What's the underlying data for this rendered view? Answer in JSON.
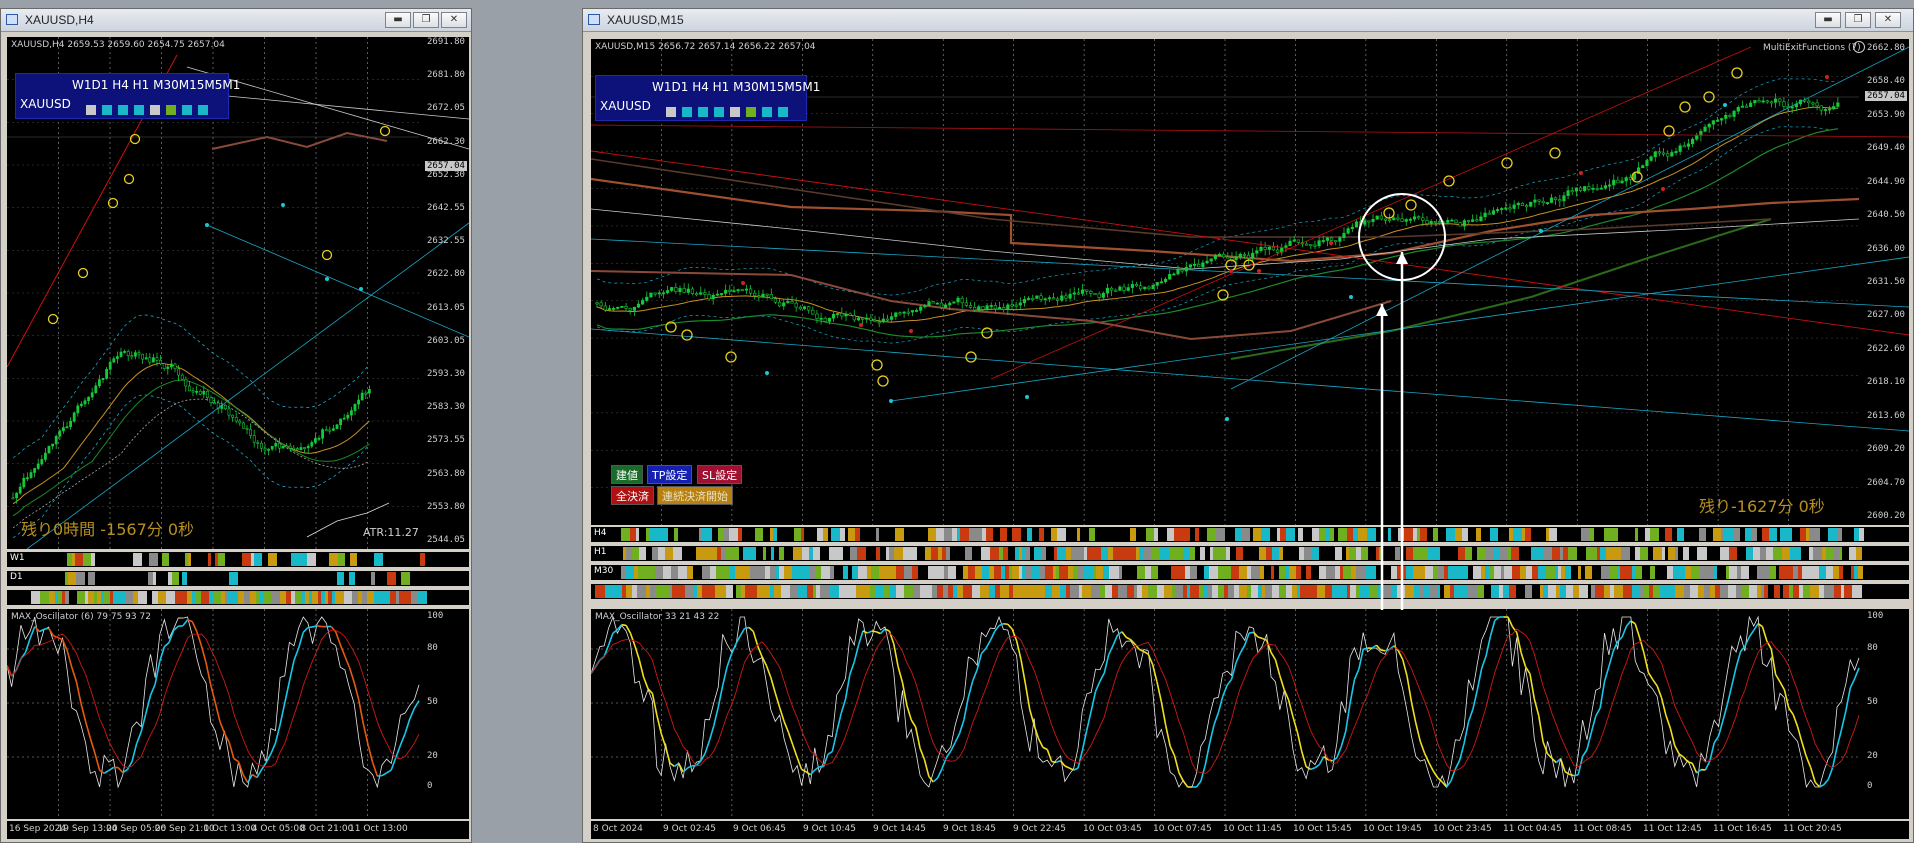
{
  "left": {
    "window_title": "XAUUSD,H4",
    "chart_header": "XAUUSD,H4  2659.53 2659.60 2654.75 2657.04",
    "tf_labels": "W1D1 H4 H1 M30M15M5M1",
    "symbol": "XAUUSD",
    "tf_squares": [
      "#c8c8c8",
      "#18b8c8",
      "#18b8c8",
      "#18b8c8",
      "#c8c8c8",
      "#70b020",
      "#18b8c8",
      "#18b8c8"
    ],
    "price_labels": [
      "2691.80",
      "2681.80",
      "2672.05",
      "2662.30",
      "2652.30",
      "2642.55",
      "2632.55",
      "2622.80",
      "2613.05",
      "2603.05",
      "2593.30",
      "2583.30",
      "2573.55",
      "2563.80",
      "2553.80",
      "2544.05"
    ],
    "current_price": "2657.04",
    "remaining": "残り0時間 -1567分 0秒",
    "atr": "ATR:11.27",
    "strip_labels": [
      "W1",
      "D1",
      ""
    ],
    "osc_title": "MAX_Oscillator (6) 79 75 93 72",
    "osc_levels": [
      "100",
      "80",
      "50",
      "20",
      "0"
    ],
    "time_labels": [
      "16 Sep 2024",
      "19 Sep 13:00",
      "24 Sep 05:00",
      "26 Sep 21:00",
      "1 Oct 13:00",
      "4 Oct 05:00",
      "8 Oct 21:00",
      "11 Oct 13:00"
    ]
  },
  "right": {
    "window_title": "XAUUSD,M15",
    "chart_header": "XAUUSD,M15  2656.72 2657.14 2656.22 2657.04",
    "indicator_name": "MultiExitFunctions (7)",
    "tf_labels": "W1D1 H4 H1 M30M15M5M1",
    "symbol": "XAUUSD",
    "tf_squares": [
      "#c8c8c8",
      "#18b8c8",
      "#18b8c8",
      "#18b8c8",
      "#c8c8c8",
      "#70b020",
      "#18b8c8",
      "#18b8c8"
    ],
    "price_labels": [
      "2662.80",
      "2658.40",
      "2653.90",
      "2649.40",
      "2644.90",
      "2640.50",
      "2636.00",
      "2631.50",
      "2627.00",
      "2622.60",
      "2618.10",
      "2613.60",
      "2609.20",
      "2604.70",
      "2600.20"
    ],
    "current_price": "2657.04",
    "buttons": {
      "entry": "建値",
      "tp": "TP設定",
      "sl": "SL設定",
      "close_all": "全決済",
      "continuous": "連続決済開始"
    },
    "remaining": "残り-1627分 0秒",
    "strip_labels": [
      "H4",
      "H1",
      "M30",
      ""
    ],
    "osc_title": "MAX_Oscillator 33 21 43 22",
    "osc_levels": [
      "100",
      "80",
      "50",
      "20",
      "0"
    ],
    "time_labels": [
      "8 Oct 2024",
      "9 Oct 02:45",
      "9 Oct 06:45",
      "9 Oct 10:45",
      "9 Oct 14:45",
      "9 Oct 18:45",
      "9 Oct 22:45",
      "10 Oct 03:45",
      "10 Oct 07:45",
      "10 Oct 11:45",
      "10 Oct 15:45",
      "10 Oct 19:45",
      "10 Oct 23:45",
      "11 Oct 04:45",
      "11 Oct 08:45",
      "11 Oct 12:45",
      "11 Oct 16:45",
      "11 Oct 20:45"
    ]
  },
  "window_buttons": {
    "minimize": "▬",
    "restore": "❐",
    "close": "✕"
  }
}
